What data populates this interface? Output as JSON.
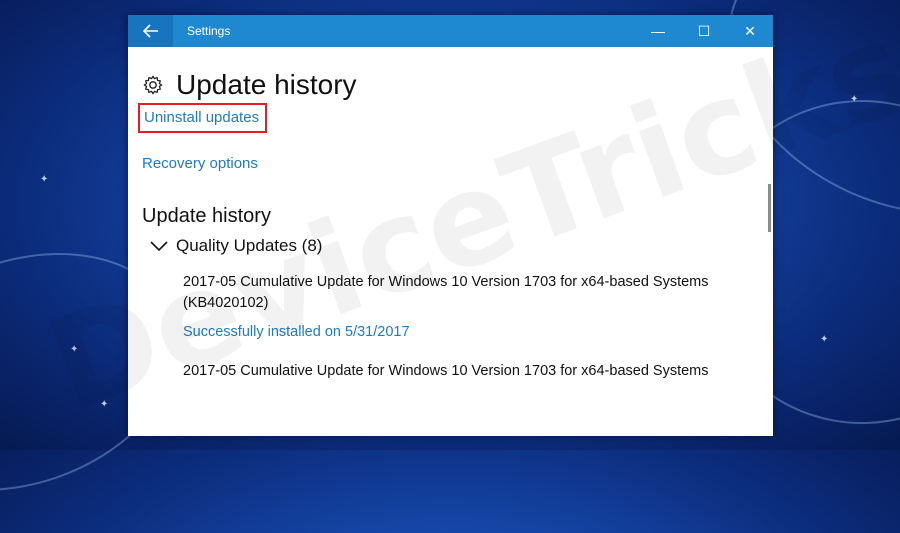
{
  "window": {
    "title": "Settings",
    "back_icon": "arrow-left-icon",
    "controls": {
      "minimize": "—",
      "maximize": "☐",
      "close": "✕"
    },
    "accent": "#1e88d0"
  },
  "page": {
    "title": "Update history",
    "icon": "gear-icon",
    "links": {
      "uninstall": "Uninstall updates",
      "recovery": "Recovery options"
    },
    "highlight_color": "#e31e24"
  },
  "history": {
    "section_title": "Update history",
    "category": "Quality Updates (8)",
    "items": [
      {
        "name": "2017-05 Cumulative Update for Windows 10 Version 1703 for x64-based Systems (KB4020102)",
        "status": "Successfully installed on 5/31/2017"
      },
      {
        "name": "2017-05 Cumulative Update for Windows 10 Version 1703 for x64-based Systems"
      }
    ]
  },
  "watermark": "DeviceTricks"
}
